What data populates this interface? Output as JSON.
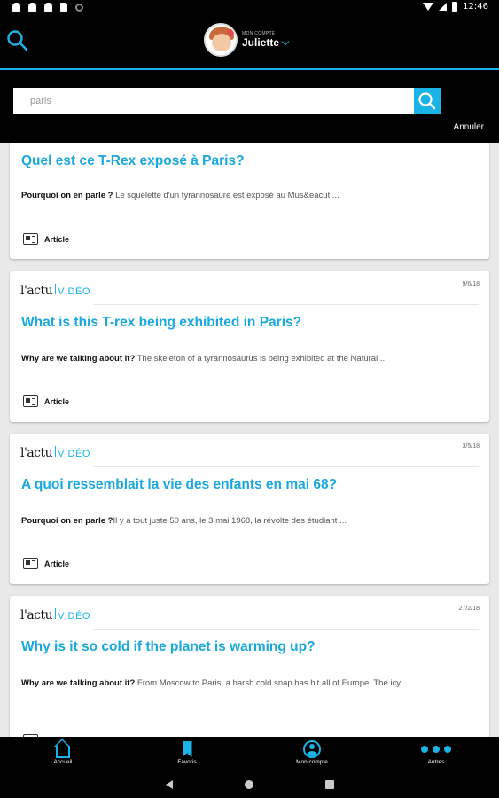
{
  "status_bar": {
    "time": "12:46"
  },
  "header": {
    "account_label": "MON COMPTE",
    "account_name": "Juliette"
  },
  "search": {
    "query": "paris",
    "cancel_label": "Annuler"
  },
  "cards": [
    {
      "brand": "",
      "date": "",
      "title": "Quel est ce T-Rex exposé à Paris?",
      "summary_lead": "Pourquoi on en parle ?",
      "summary_text": " Le squelette d'un tyrannosaure est exposé au Mus&eacut ...",
      "kind": "Article"
    },
    {
      "brand": "l'actu",
      "brand_suffix": "VIDÉO",
      "date": "9/6/18",
      "title": "What is this T-rex being exhibited in Paris?",
      "summary_lead": "Why are we talking about it?",
      "summary_text": " The skeleton of a tyrannosaurus is being exhibited at the Natural ...",
      "kind": "Article"
    },
    {
      "brand": "l'actu",
      "brand_suffix": "VIDÉO",
      "date": "3/5/18",
      "title": "A quoi ressemblait la vie des enfants en mai 68?",
      "summary_lead": "Pourquoi on en parle ?",
      "summary_text": "Il y a tout juste 50 ans, le 3 mai 1968, la révolte des étudiant ...",
      "kind": "Article"
    },
    {
      "brand": "l'actu",
      "brand_suffix": "VIDÉO",
      "date": "27/2/18",
      "title": "Why is it so cold if the planet is warming up?",
      "summary_lead": "Why are we talking about it?",
      "summary_text": " From Moscow to Paris, a harsh cold snap has hit all of Europe. The icy ...",
      "kind": "Article"
    }
  ],
  "bottom_nav": {
    "items": [
      {
        "label": "Accueil",
        "icon": "home-icon"
      },
      {
        "label": "Favoris",
        "icon": "bookmark-icon"
      },
      {
        "label": "Mon compte",
        "icon": "account-icon"
      },
      {
        "label": "Autres",
        "icon": "more-dots-icon"
      }
    ]
  },
  "colors": {
    "accent": "#19b3e6",
    "background": "#e9e9e9",
    "bar": "#000000"
  }
}
